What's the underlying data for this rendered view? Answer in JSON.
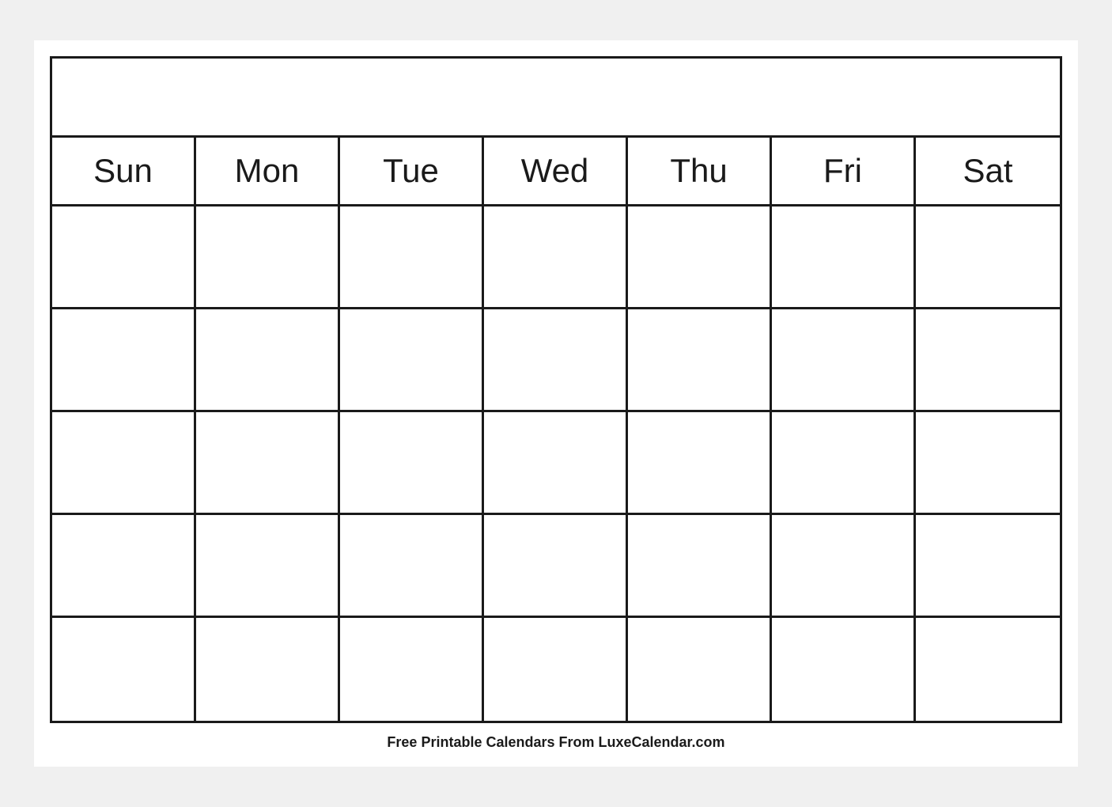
{
  "calendar": {
    "days": [
      "Sun",
      "Mon",
      "Tue",
      "Wed",
      "Thu",
      "Fri",
      "Sat"
    ],
    "weeks": 5
  },
  "footer": {
    "text": "Free Printable Calendars From LuxeCalendar.com"
  }
}
